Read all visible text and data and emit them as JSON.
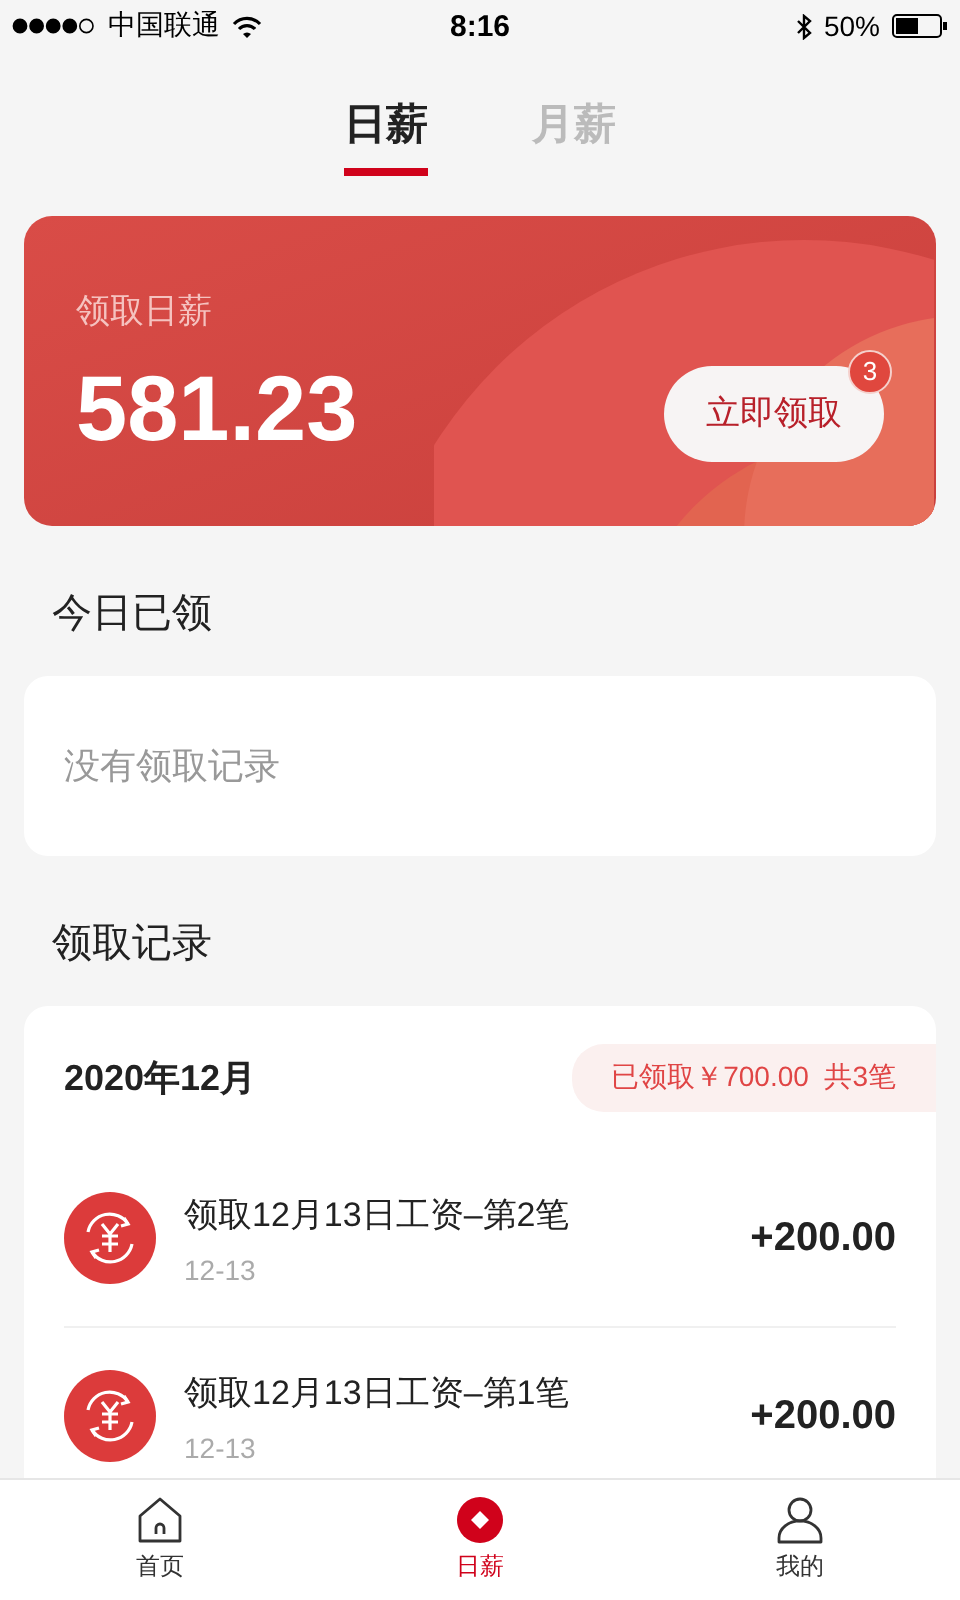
{
  "status_bar": {
    "carrier": "中国联通",
    "time": "8:16",
    "battery": "50%"
  },
  "tabs": [
    {
      "label": "日薪",
      "selected": true
    },
    {
      "label": "月薪",
      "selected": false
    }
  ],
  "salary_card": {
    "label": "领取日薪",
    "amount": "581.23",
    "button": "立即领取",
    "badge": "3"
  },
  "today": {
    "title": "今日已领",
    "empty_text": "没有领取记录"
  },
  "records": {
    "title": "领取记录",
    "month": "2020年12月",
    "summary": "已领取￥700.00  共3笔",
    "items": [
      {
        "title": "领取12月13日工资–第2笔",
        "date": "12-13",
        "amount": "+200.00"
      },
      {
        "title": "领取12月13日工资–第1笔",
        "date": "12-13",
        "amount": "+200.00"
      }
    ]
  },
  "bottom_nav": [
    {
      "label": "首页",
      "kind": "home",
      "selected": false
    },
    {
      "label": "日薪",
      "kind": "coin",
      "selected": true
    },
    {
      "label": "我的",
      "kind": "person",
      "selected": false
    }
  ]
}
